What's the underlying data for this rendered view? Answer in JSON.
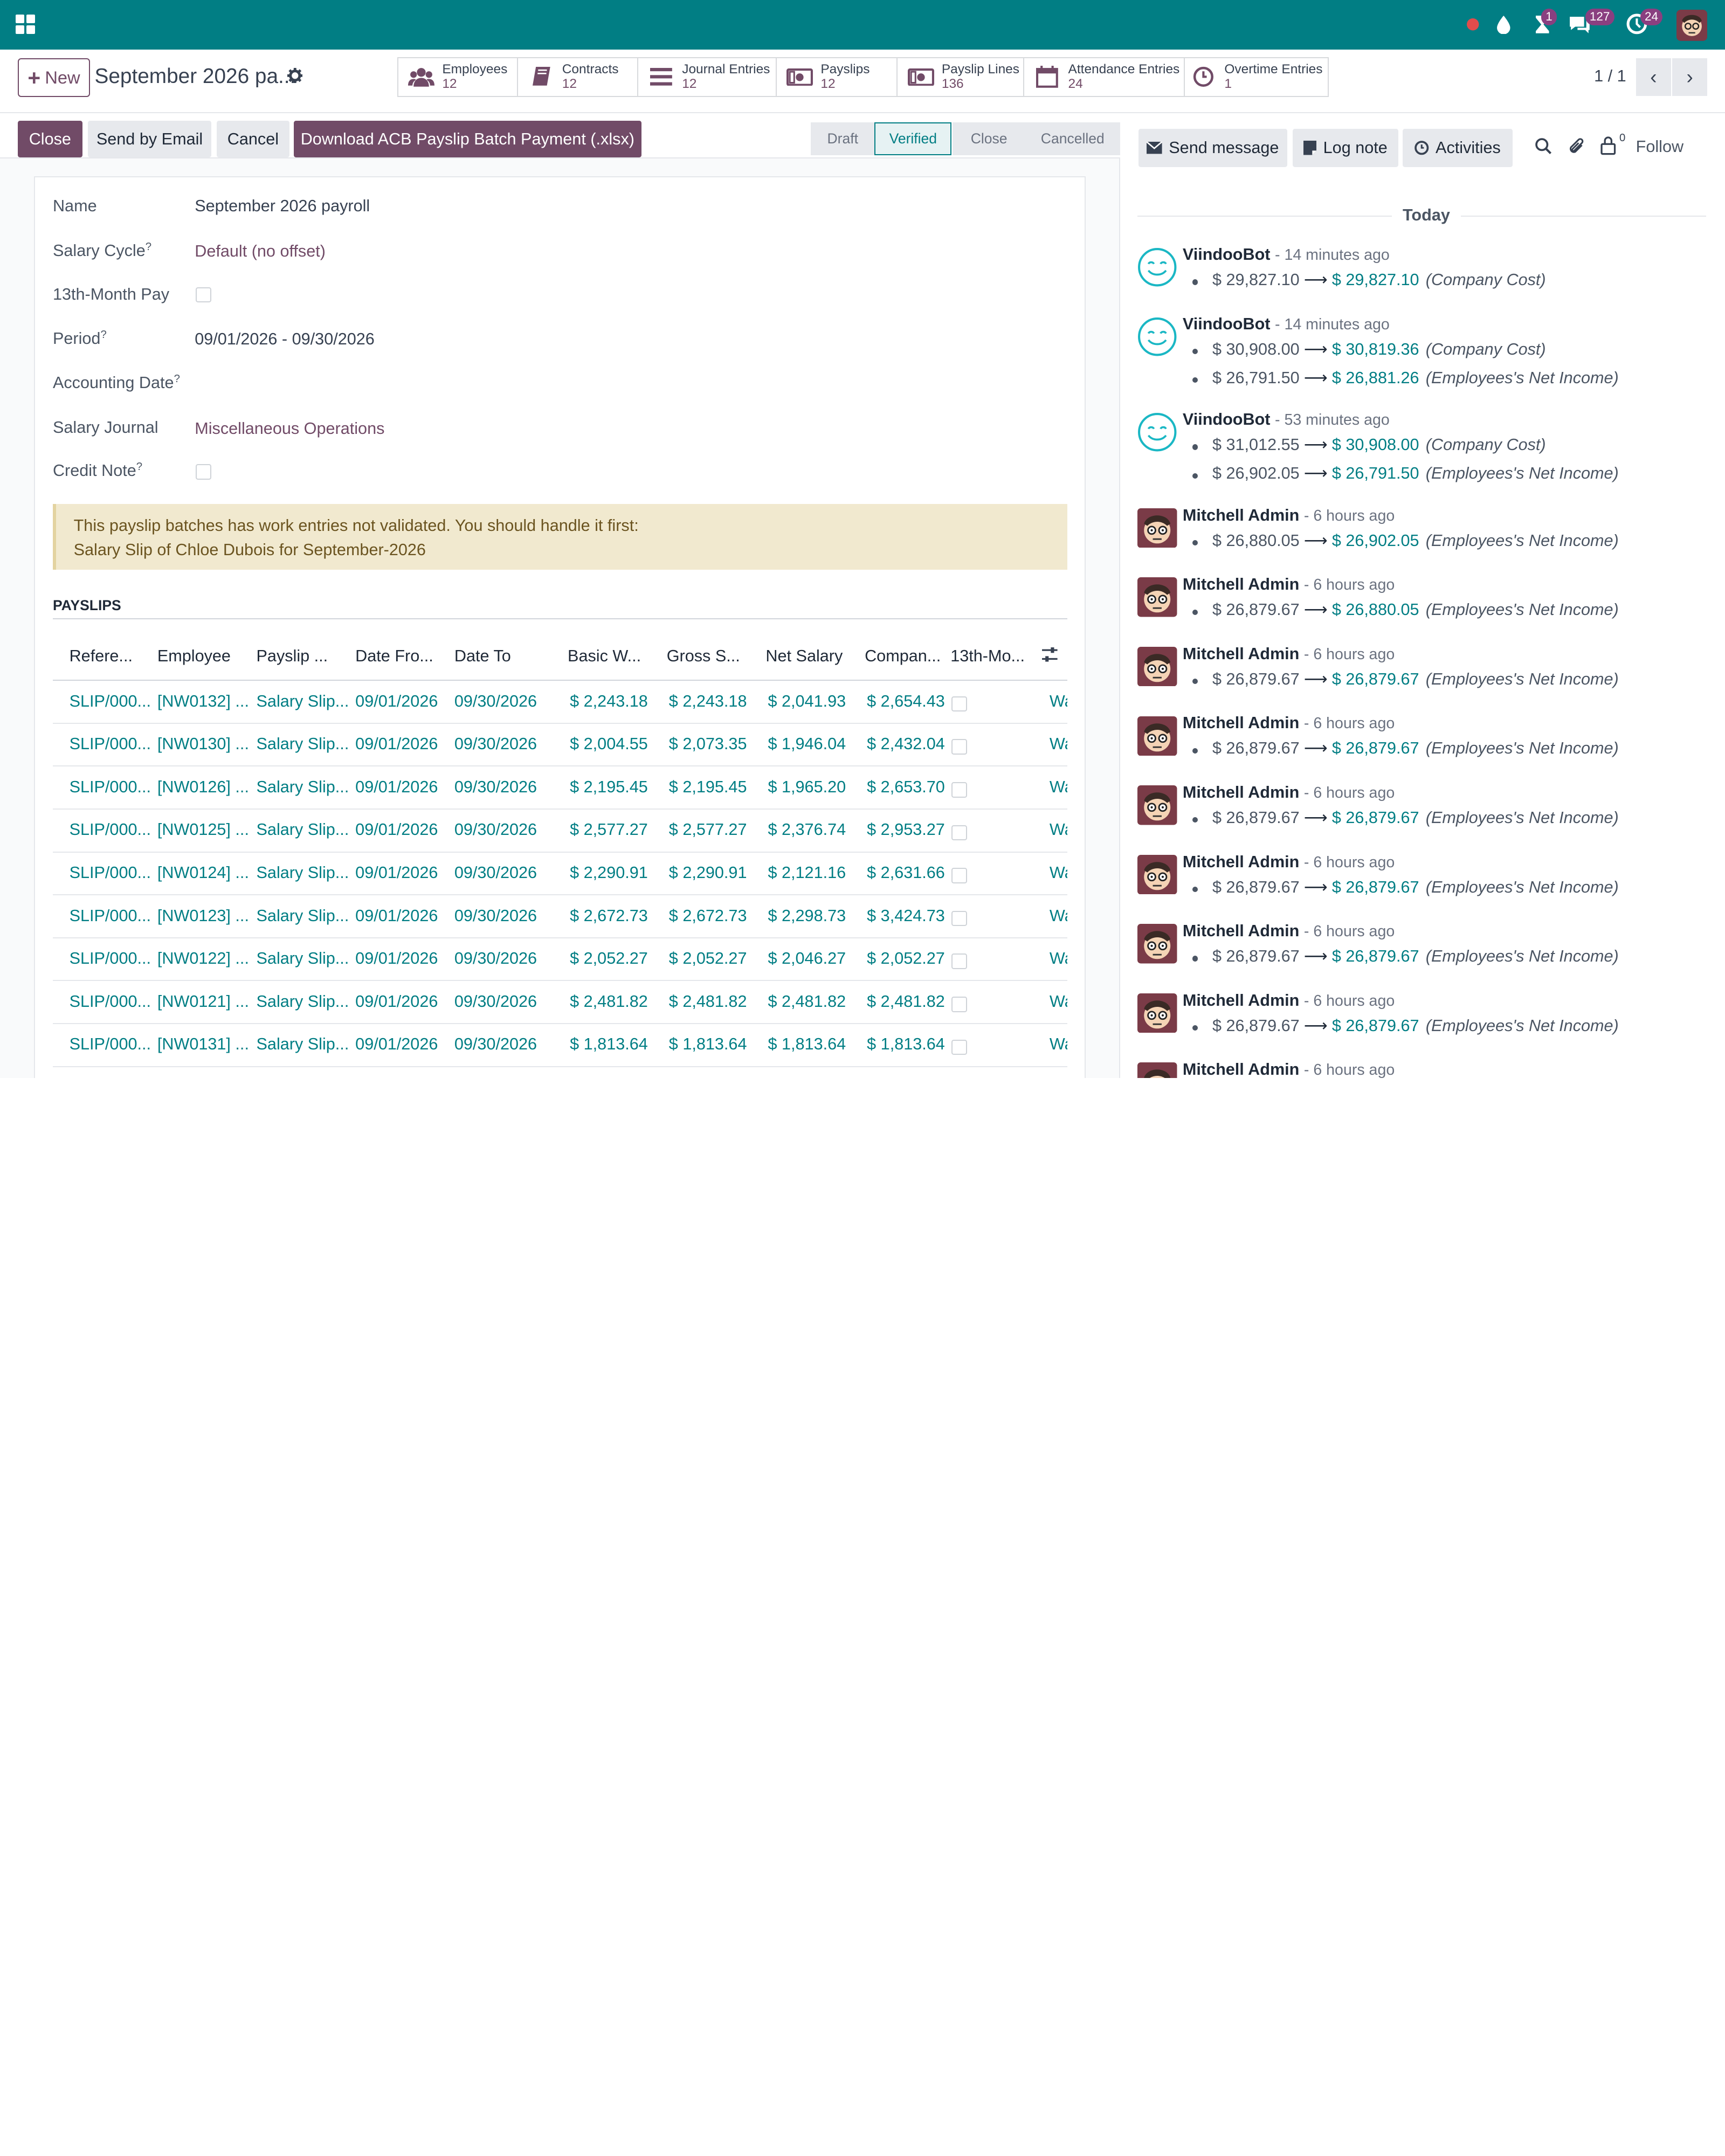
{
  "topbar": {
    "color": "#017e84",
    "activity_count": "1",
    "messages_count": "127",
    "notifications_count": "24"
  },
  "control": {
    "new_label": "New",
    "record_title": "September 2026 pa...",
    "pager": "1 / 1",
    "smart_buttons": [
      {
        "label": "Employees",
        "count": "12",
        "icon": "users-icon"
      },
      {
        "label": "Contracts",
        "count": "12",
        "icon": "book-icon"
      },
      {
        "label": "Journal Entries",
        "count": "12",
        "icon": "list-icon"
      },
      {
        "label": "Payslips",
        "count": "12",
        "icon": "money-icon"
      },
      {
        "label": "Payslip Lines",
        "count": "136",
        "icon": "money-icon"
      },
      {
        "label": "Attendance Entries",
        "count": "24",
        "icon": "calendar-icon"
      },
      {
        "label": "Overtime Entries",
        "count": "1",
        "icon": "clock-icon"
      }
    ]
  },
  "actions": {
    "close": "Close",
    "send_email": "Send by Email",
    "cancel": "Cancel",
    "download": "Download ACB Payslip Batch Payment (.xlsx)"
  },
  "stages": [
    "Draft",
    "Verified",
    "Close",
    "Cancelled"
  ],
  "form": {
    "name_label": "Name",
    "name_value": "September 2026 payroll",
    "salary_cycle_label": "Salary Cycle",
    "salary_cycle_value": "Default (no offset)",
    "thirteenth_label": "13th-Month Pay",
    "period_label": "Period",
    "period_value": "09/01/2026 - 09/30/2026",
    "accounting_date_label": "Accounting Date",
    "journal_label": "Salary Journal",
    "journal_value": "Miscellaneous Operations",
    "credit_note_label": "Credit Note",
    "help_mark": "?"
  },
  "alert": {
    "line1": "This payslip batches has work entries not validated. You should handle it first:",
    "line2": "Salary Slip of Chloe Dubois for September-2026"
  },
  "payslips": {
    "section_title": "PAYSLIPS",
    "columns": [
      "Refere...",
      "Employee",
      "Payslip ...",
      "Date Fro...",
      "Date To",
      "Basic W...",
      "Gross S...",
      "Net Salary",
      "Compan...",
      "13th-Mo..."
    ],
    "rows": [
      [
        "SLIP/000...",
        "[NW0132] ...",
        "Salary Slip...",
        "09/01/2026",
        "09/30/2026",
        "$ 2,243.18",
        "$ 2,243.18",
        "$ 2,041.93",
        "$ 2,654.43",
        "Wa"
      ],
      [
        "SLIP/000...",
        "[NW0130] ...",
        "Salary Slip...",
        "09/01/2026",
        "09/30/2026",
        "$ 2,004.55",
        "$ 2,073.35",
        "$ 1,946.04",
        "$ 2,432.04",
        "Wa"
      ],
      [
        "SLIP/000...",
        "[NW0126] ...",
        "Salary Slip...",
        "09/01/2026",
        "09/30/2026",
        "$ 2,195.45",
        "$ 2,195.45",
        "$ 1,965.20",
        "$ 2,653.70",
        "Wa"
      ],
      [
        "SLIP/000...",
        "[NW0125] ...",
        "Salary Slip...",
        "09/01/2026",
        "09/30/2026",
        "$ 2,577.27",
        "$ 2,577.27",
        "$ 2,376.74",
        "$ 2,953.27",
        "Wa"
      ],
      [
        "SLIP/000...",
        "[NW0124] ...",
        "Salary Slip...",
        "09/01/2026",
        "09/30/2026",
        "$ 2,290.91",
        "$ 2,290.91",
        "$ 2,121.16",
        "$ 2,631.66",
        "Wa"
      ],
      [
        "SLIP/000...",
        "[NW0123] ...",
        "Salary Slip...",
        "09/01/2026",
        "09/30/2026",
        "$ 2,672.73",
        "$ 2,672.73",
        "$ 2,298.73",
        "$ 3,424.73",
        "Wa"
      ],
      [
        "SLIP/000...",
        "[NW0122] ...",
        "Salary Slip...",
        "09/01/2026",
        "09/30/2026",
        "$ 2,052.27",
        "$ 2,052.27",
        "$ 2,046.27",
        "$ 2,052.27",
        "Wa"
      ],
      [
        "SLIP/000...",
        "[NW0121] ...",
        "Salary Slip...",
        "09/01/2026",
        "09/30/2026",
        "$ 2,481.82",
        "$ 2,481.82",
        "$ 2,481.82",
        "$ 2,481.82",
        "Wa"
      ],
      [
        "SLIP/000...",
        "[NW0131] ...",
        "Salary Slip...",
        "09/01/2026",
        "09/30/2026",
        "$ 1,813.64",
        "$ 1,813.64",
        "$ 1,813.64",
        "$ 1,813.64",
        "Wa"
      ]
    ]
  },
  "chatter": {
    "send_message": "Send message",
    "log_note": "Log note",
    "activities": "Activities",
    "follower_count": "0",
    "follow": "Follow",
    "today": "Today",
    "messages": [
      {
        "author": "ViindooBot",
        "time": "- 14 minutes ago",
        "bot": true,
        "tracks": [
          {
            "old": "$ 29,827.10",
            "new": "$ 29,827.10",
            "field": "(Company Cost)"
          }
        ]
      },
      {
        "author": "ViindooBot",
        "time": "- 14 minutes ago",
        "bot": true,
        "tracks": [
          {
            "old": "$ 30,908.00",
            "new": "$ 30,819.36",
            "field": "(Company Cost)"
          },
          {
            "old": "$ 26,791.50",
            "new": "$ 26,881.26",
            "field": "(Employees's Net Income)"
          }
        ]
      },
      {
        "author": "ViindooBot",
        "time": "- 53 minutes ago",
        "bot": true,
        "tracks": [
          {
            "old": "$ 31,012.55",
            "new": "$ 30,908.00",
            "field": "(Company Cost)"
          },
          {
            "old": "$ 26,902.05",
            "new": "$ 26,791.50",
            "field": "(Employees's Net Income)"
          }
        ]
      },
      {
        "author": "Mitchell Admin",
        "time": "- 6 hours ago",
        "bot": false,
        "tracks": [
          {
            "old": "$ 26,880.05",
            "new": "$ 26,902.05",
            "field": "(Employees's Net Income)"
          }
        ]
      },
      {
        "author": "Mitchell Admin",
        "time": "- 6 hours ago",
        "bot": false,
        "tracks": [
          {
            "old": "$ 26,879.67",
            "new": "$ 26,880.05",
            "field": "(Employees's Net Income)"
          }
        ]
      },
      {
        "author": "Mitchell Admin",
        "time": "- 6 hours ago",
        "bot": false,
        "tracks": [
          {
            "old": "$ 26,879.67",
            "new": "$ 26,879.67",
            "field": "(Employees's Net Income)"
          }
        ]
      },
      {
        "author": "Mitchell Admin",
        "time": "- 6 hours ago",
        "bot": false,
        "tracks": [
          {
            "old": "$ 26,879.67",
            "new": "$ 26,879.67",
            "field": "(Employees's Net Income)"
          }
        ]
      },
      {
        "author": "Mitchell Admin",
        "time": "- 6 hours ago",
        "bot": false,
        "tracks": [
          {
            "old": "$ 26,879.67",
            "new": "$ 26,879.67",
            "field": "(Employees's Net Income)"
          }
        ]
      },
      {
        "author": "Mitchell Admin",
        "time": "- 6 hours ago",
        "bot": false,
        "tracks": [
          {
            "old": "$ 26,879.67",
            "new": "$ 26,879.67",
            "field": "(Employees's Net Income)"
          }
        ]
      },
      {
        "author": "Mitchell Admin",
        "time": "- 6 hours ago",
        "bot": false,
        "tracks": [
          {
            "old": "$ 26,879.67",
            "new": "$ 26,879.67",
            "field": "(Employees's Net Income)"
          }
        ]
      },
      {
        "author": "Mitchell Admin",
        "time": "- 6 hours ago",
        "bot": false,
        "tracks": [
          {
            "old": "$ 26,879.67",
            "new": "$ 26,879.67",
            "field": "(Employees's Net Income)"
          }
        ]
      },
      {
        "author": "Mitchell Admin",
        "time": "- 6 hours ago",
        "bot": false,
        "tracks": []
      }
    ]
  }
}
